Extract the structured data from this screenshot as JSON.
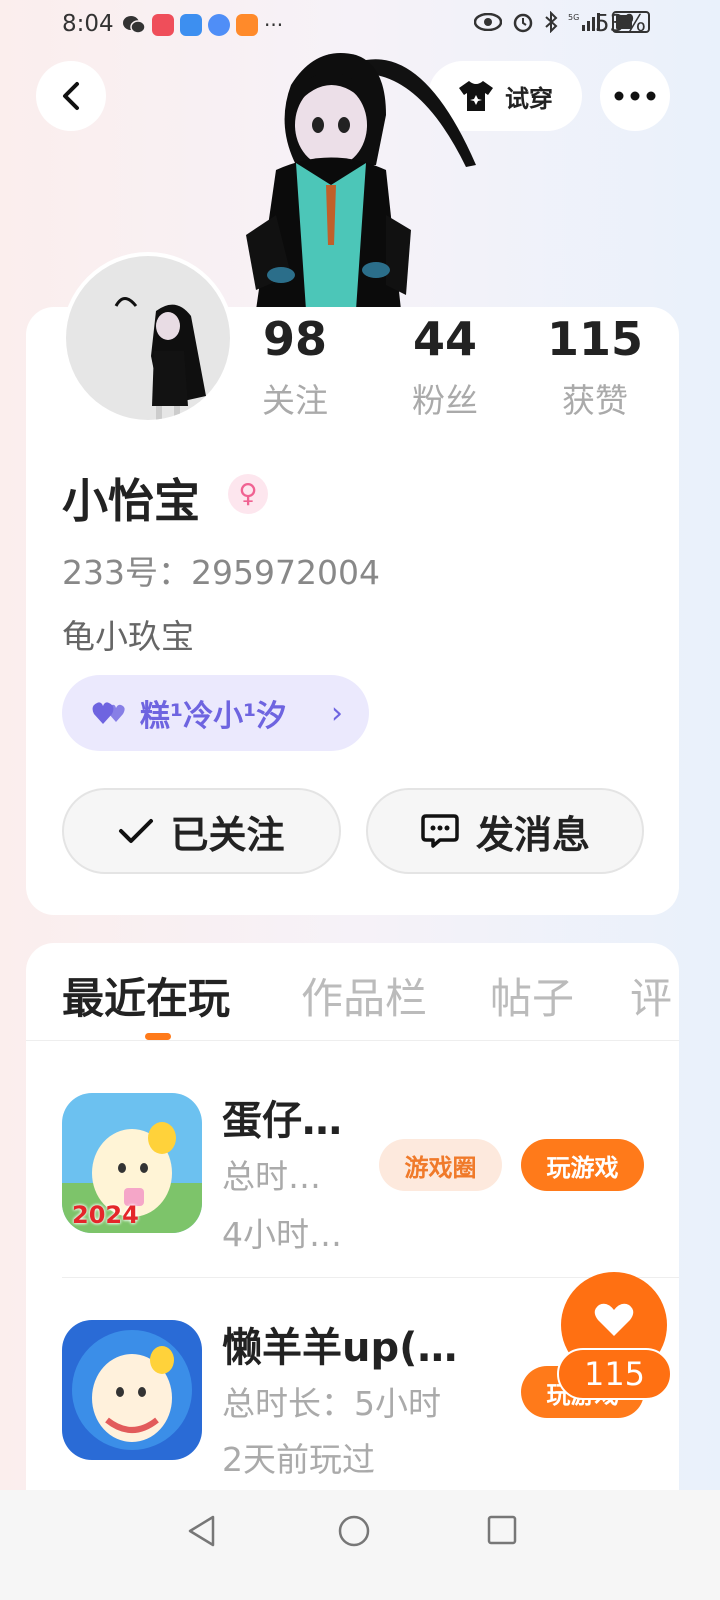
{
  "status_bar": {
    "time": "8:04",
    "battery": "53%",
    "network": "5G"
  },
  "header": {
    "back_icon": "chevron-left-icon",
    "try_on_label": "试穿",
    "try_on_icon": "tshirt-icon",
    "more_icon": "more-dots-icon"
  },
  "profile": {
    "stats": [
      {
        "value": "98",
        "label": "关注"
      },
      {
        "value": "44",
        "label": "粉丝"
      },
      {
        "value": "115",
        "label": "获赞"
      }
    ],
    "name": "小怡宝",
    "gender_icon": "female-icon",
    "id_line": "233号：295972004",
    "bio": "龟小玖宝",
    "cp_name": "糕¹冷小¹汐",
    "cp_icon": "double-heart-icon",
    "follow_label": "已关注",
    "message_label": "发消息"
  },
  "tabs": [
    "最近在玩",
    "作品栏",
    "帖子",
    "评"
  ],
  "games": [
    {
      "title": "蛋仔…",
      "line1": "总时…",
      "line2": "4小时…",
      "icon_badge": "2024",
      "circle_label": "游戏圈",
      "play_label": "玩游戏"
    },
    {
      "title": "懒羊羊up(…",
      "line1": "总时长：5小时",
      "line2": "2天前玩过",
      "play_label": "玩游戏"
    }
  ],
  "like": {
    "count": "115",
    "icon": "heart-icon"
  },
  "colors": {
    "accent": "#ff7a1a",
    "cp_text": "#6e64e0",
    "cp_bg": "#ebe9fd"
  }
}
